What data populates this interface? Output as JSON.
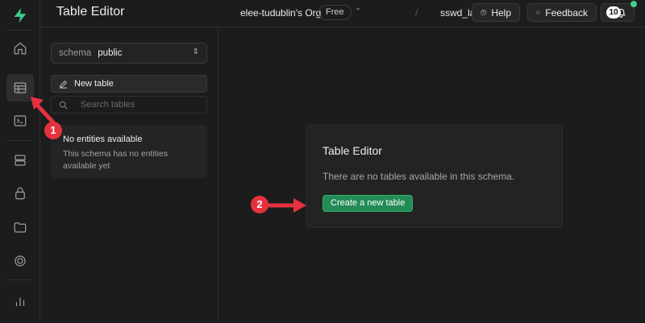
{
  "header": {
    "title": "Table Editor",
    "org_name": "elee-tudublin's Org",
    "plan": "Free",
    "project_name": "sswd_labs",
    "help_label": "Help",
    "feedback_label": "Feedback",
    "notification_count": "10"
  },
  "rail": {
    "items": [
      "home-icon",
      "table-icon",
      "terminal-icon",
      "database-icon",
      "auth-icon",
      "storage-icon",
      "realtime-icon",
      "reports-icon"
    ],
    "active": "table-icon"
  },
  "sidebar": {
    "schema_label": "schema",
    "schema_value": "public",
    "new_table_label": "New table",
    "search_placeholder": "Search tables",
    "empty_title": "No entities available",
    "empty_desc": "This schema has no entities available yet"
  },
  "main": {
    "card_title": "Table Editor",
    "card_message": "There are no tables available in this schema.",
    "create_button_label": "Create a new table"
  },
  "annotations": [
    {
      "number": "1"
    },
    {
      "number": "2"
    }
  ],
  "colors": {
    "brand": "#3ecf8e",
    "button": "#238c56",
    "annotation": "#e5323e"
  }
}
